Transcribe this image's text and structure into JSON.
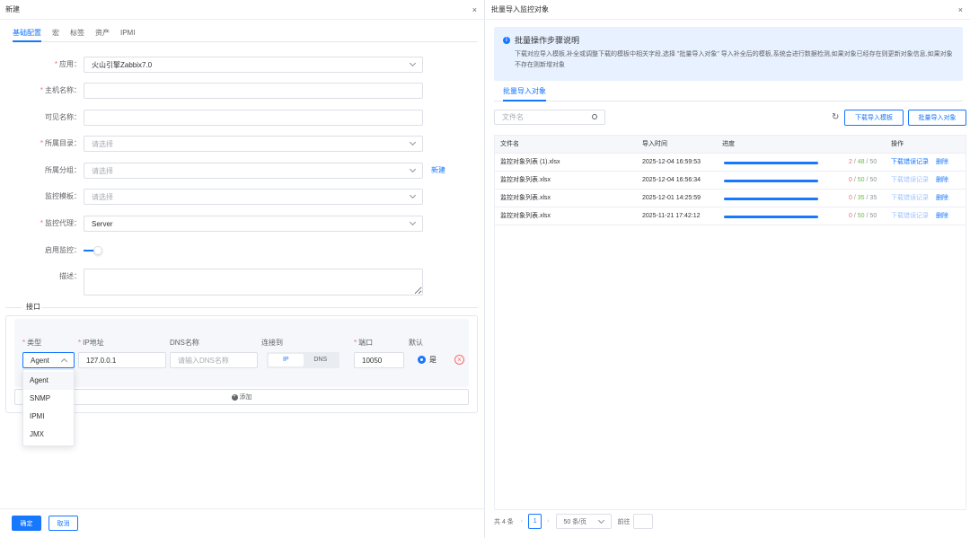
{
  "left": {
    "title": "新建",
    "close": "×",
    "tabs": [
      "基础配置",
      "宏",
      "标签",
      "资产",
      "IPMI"
    ],
    "fields": {
      "app": {
        "label": "应用：",
        "value": "火山引擎Zabbix7.0"
      },
      "host": {
        "label": "主机名称：",
        "value": ""
      },
      "visible": {
        "label": "可见名称：",
        "value": ""
      },
      "dir": {
        "label": "所属目录：",
        "placeholder": "请选择"
      },
      "group": {
        "label": "所属分组：",
        "placeholder": "请选择",
        "link": "新建"
      },
      "template": {
        "label": "监控模板：",
        "placeholder": "请选择"
      },
      "proxy": {
        "label": "监控代理：",
        "value": "Server"
      },
      "enable": {
        "label": "启用监控："
      },
      "desc": {
        "label": "描述："
      }
    },
    "interface": {
      "section": "接口",
      "headers": {
        "type": "类型",
        "ip": "IP地址",
        "dns": "DNS名称",
        "connect": "连接到",
        "port": "端口",
        "default": "默认"
      },
      "type_value": "Agent",
      "ip_value": "127.0.0.1",
      "dns_placeholder": "请输入DNS名称",
      "connect_opts": [
        "IP",
        "DNS"
      ],
      "port_value": "10050",
      "default_label": "是",
      "add": "添加",
      "dropdown": [
        "Agent",
        "SNMP",
        "IPMI",
        "JMX"
      ]
    },
    "footer": {
      "ok": "确定",
      "cancel": "取消"
    }
  },
  "right": {
    "title": "批量导入监控对象",
    "close": "×",
    "info_title": "批量操作步骤说明",
    "info_desc": "下载对应导入模板,补全或调整下载的模板中相关字段,选择 \"批量导入对象\" 导入补全后的模板,系统会进行数据检测,如果对象已经存在则更新对象信息,如果对象不存在则新增对象",
    "tab": "批量导入对象",
    "search_placeholder": "文件名",
    "btn_download": "下载导入模板",
    "btn_import": "批量导入对象",
    "columns": {
      "file": "文件名",
      "time": "导入时间",
      "progress": "进度",
      "ops": "操作"
    },
    "rows": [
      {
        "file": "监控对象列表 (1).xlsx",
        "time": "2025-12-04 16:59:53",
        "fail": "2",
        "ok": "48",
        "total": "50",
        "progress": 1.0,
        "err": "下载错误记录",
        "del": "删除",
        "err_active": true
      },
      {
        "file": "监控对象列表.xlsx",
        "time": "2025-12-04 16:56:34",
        "fail": "0",
        "ok": "50",
        "total": "50",
        "progress": 1.0,
        "err": "下载错误记录",
        "del": "删除",
        "err_active": false
      },
      {
        "file": "监控对象列表.xlsx",
        "time": "2025-12-01 14:25:59",
        "fail": "0",
        "ok": "35",
        "total": "35",
        "progress": 1.0,
        "err": "下载错误记录",
        "del": "删除",
        "err_active": false
      },
      {
        "file": "监控对象列表.xlsx",
        "time": "2025-11-21 17:42:12",
        "fail": "0",
        "ok": "50",
        "total": "50",
        "progress": 1.0,
        "err": "下载错误记录",
        "del": "删除",
        "err_active": false
      }
    ],
    "pager": {
      "total": "共 4 条",
      "page": "1",
      "size": "50 条/页",
      "goto": "前往"
    }
  }
}
